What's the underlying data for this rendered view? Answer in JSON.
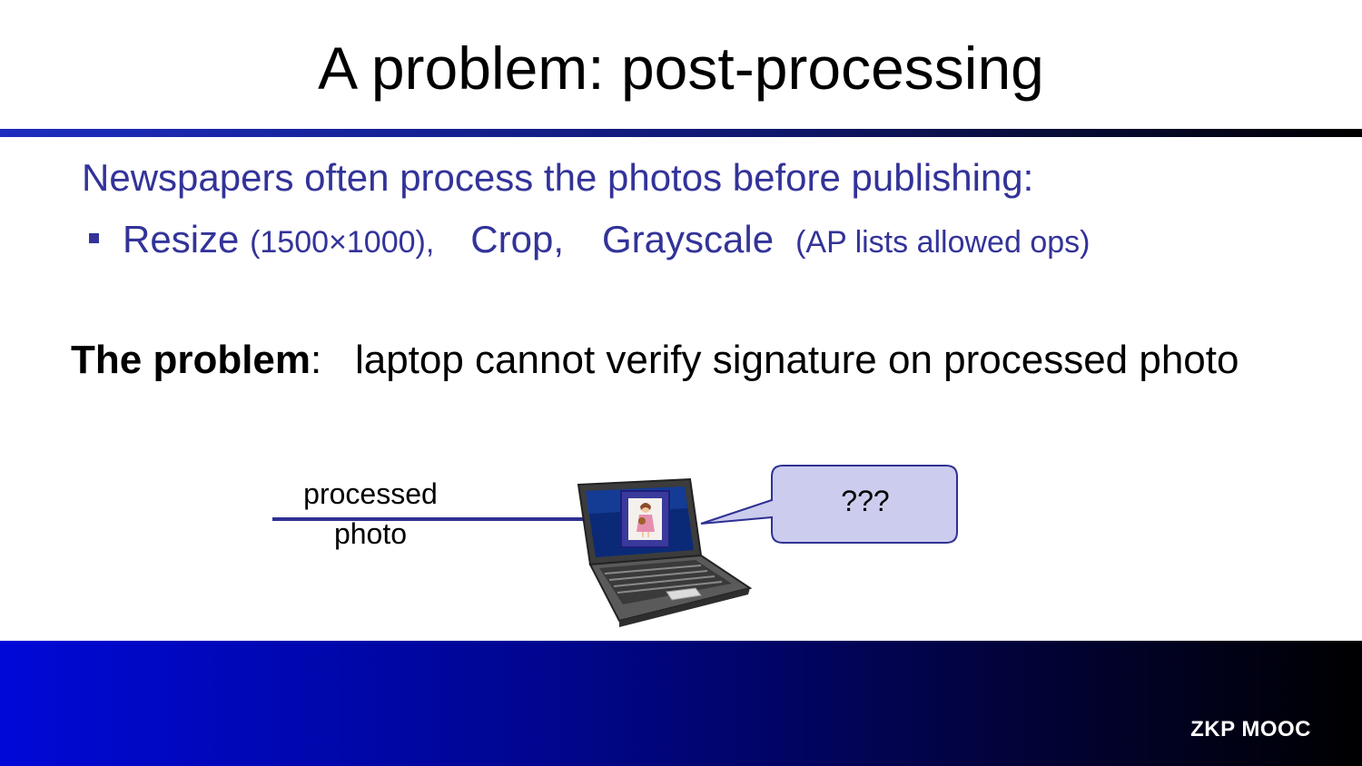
{
  "slide": {
    "title": "A problem:  post-processing",
    "lead": "Newspapers often process the photos before publishing:",
    "bullet": {
      "resize": "Resize",
      "resize_note": "(1500×1000),",
      "crop": "Crop,",
      "grayscale": "Grayscale",
      "ap_note": "(AP lists allowed ops)"
    },
    "problem": {
      "label": "The problem",
      "colon": ":",
      "text": "laptop cannot verify signature on processed photo"
    }
  },
  "diagram": {
    "arrow_label_line1": "processed",
    "arrow_label_line2": "photo",
    "bubble_text": "???",
    "icons": [
      "laptop-icon",
      "photo-icon",
      "speech-bubble"
    ]
  },
  "footer": {
    "tag": "ZKP MOOC"
  },
  "colors": {
    "accent_text": "#333399",
    "arrow": "#2e3192",
    "bubble_fill": "#ccccee",
    "bubble_stroke": "#2e3192",
    "footer_start": "#0008d8",
    "footer_end": "#000000"
  }
}
